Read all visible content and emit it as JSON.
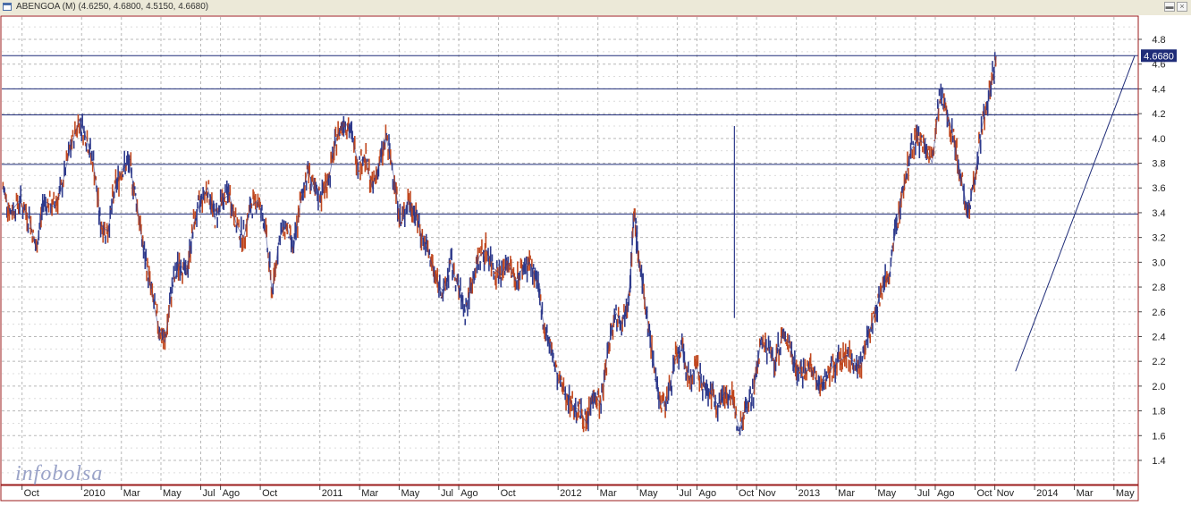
{
  "window": {
    "title": "ABENGOA (M) (4.6250, 4.6800, 4.5150, 4.6680)",
    "icon": "chart-window-icon",
    "buttons": [
      "minimize-icon",
      "close-icon"
    ]
  },
  "watermark": {
    "left": "info",
    "right": "bolsa"
  },
  "colors": {
    "up": "#2e3a8c",
    "down": "#c0471e",
    "grid": "#b8b8b8",
    "hline": "#1f2c78",
    "frame": "#9b1b1b",
    "price_tag_bg": "#1f2c78"
  },
  "last_price_label": "4.6680",
  "chart_data": {
    "type": "line",
    "title": "ABENGOA (M)",
    "subtitle": "(4.6250, 4.6800, 4.5150, 4.6680)",
    "xlabel": "",
    "ylabel": "",
    "ylim": [
      1.2,
      5.0
    ],
    "y_ticks": [
      1.4,
      1.6,
      1.8,
      2.0,
      2.2,
      2.4,
      2.6,
      2.8,
      3.0,
      3.2,
      3.4,
      3.6,
      3.8,
      4.0,
      4.2,
      4.4,
      4.6,
      4.8
    ],
    "y_tick_labels": [
      "1.4",
      "1.6",
      "1.8",
      "2.0",
      "2.2",
      "2.4",
      "2.6",
      "2.8",
      "3.0",
      "3.2",
      "3.4",
      "3.6",
      "3.8",
      "4.0",
      "4.2",
      "4.4",
      "4.6",
      "4.8"
    ],
    "x_ticks": [
      {
        "label": "Oct",
        "t": 2009.75
      },
      {
        "label": "2010",
        "t": 2010.0
      },
      {
        "label": "Mar",
        "t": 2010.167
      },
      {
        "label": "May",
        "t": 2010.333
      },
      {
        "label": "Jul",
        "t": 2010.5
      },
      {
        "label": "Ago",
        "t": 2010.583
      },
      {
        "label": "Oct",
        "t": 2010.75
      },
      {
        "label": "2011",
        "t": 2011.0
      },
      {
        "label": "Mar",
        "t": 2011.167
      },
      {
        "label": "May",
        "t": 2011.333
      },
      {
        "label": "Jul",
        "t": 2011.5
      },
      {
        "label": "Ago",
        "t": 2011.583
      },
      {
        "label": "Oct",
        "t": 2011.75
      },
      {
        "label": "2012",
        "t": 2012.0
      },
      {
        "label": "Mar",
        "t": 2012.167
      },
      {
        "label": "May",
        "t": 2012.333
      },
      {
        "label": "Jul",
        "t": 2012.5
      },
      {
        "label": "Ago",
        "t": 2012.583
      },
      {
        "label": "Oct",
        "t": 2012.75
      },
      {
        "label": "Nov",
        "t": 2012.833
      },
      {
        "label": "2013",
        "t": 2013.0
      },
      {
        "label": "Mar",
        "t": 2013.167
      },
      {
        "label": "May",
        "t": 2013.333
      },
      {
        "label": "Jul",
        "t": 2013.5
      },
      {
        "label": "Ago",
        "t": 2013.583
      },
      {
        "label": "Oct",
        "t": 2013.75
      },
      {
        "label": "Nov",
        "t": 2013.833
      },
      {
        "label": "2014",
        "t": 2014.0
      },
      {
        "label": "Mar",
        "t": 2014.167
      },
      {
        "label": "May",
        "t": 2014.333
      }
    ],
    "horizontal_lines": [
      3.39,
      3.79,
      4.19,
      4.4,
      4.668
    ],
    "trendline": {
      "start": {
        "t": 2013.92,
        "y": 2.12
      },
      "end": {
        "t": 2014.42,
        "y": 4.668
      }
    },
    "series": [
      {
        "values": [
          [
            2009.67,
            3.6
          ],
          [
            2009.7,
            3.4
          ],
          [
            2009.74,
            3.5
          ],
          [
            2009.78,
            3.35
          ],
          [
            2009.81,
            3.1
          ],
          [
            2009.84,
            3.5
          ],
          [
            2009.88,
            3.45
          ],
          [
            2009.91,
            3.55
          ],
          [
            2009.95,
            3.9
          ],
          [
            2009.99,
            4.15
          ],
          [
            2010.02,
            4.0
          ],
          [
            2010.05,
            3.8
          ],
          [
            2010.08,
            3.3
          ],
          [
            2010.11,
            3.25
          ],
          [
            2010.14,
            3.6
          ],
          [
            2010.17,
            3.75
          ],
          [
            2010.2,
            3.8
          ],
          [
            2010.23,
            3.5
          ],
          [
            2010.26,
            3.1
          ],
          [
            2010.29,
            2.8
          ],
          [
            2010.32,
            2.5
          ],
          [
            2010.35,
            2.35
          ],
          [
            2010.38,
            2.8
          ],
          [
            2010.41,
            3.0
          ],
          [
            2010.44,
            2.9
          ],
          [
            2010.47,
            3.3
          ],
          [
            2010.5,
            3.5
          ],
          [
            2010.53,
            3.6
          ],
          [
            2010.56,
            3.35
          ],
          [
            2010.59,
            3.5
          ],
          [
            2010.62,
            3.55
          ],
          [
            2010.65,
            3.3
          ],
          [
            2010.68,
            3.2
          ],
          [
            2010.71,
            3.45
          ],
          [
            2010.74,
            3.5
          ],
          [
            2010.77,
            3.3
          ],
          [
            2010.8,
            2.75
          ],
          [
            2010.83,
            3.2
          ],
          [
            2010.86,
            3.3
          ],
          [
            2010.89,
            3.1
          ],
          [
            2010.92,
            3.5
          ],
          [
            2010.95,
            3.75
          ],
          [
            2010.98,
            3.55
          ],
          [
            2011.01,
            3.55
          ],
          [
            2011.04,
            3.7
          ],
          [
            2011.07,
            4.0
          ],
          [
            2011.1,
            4.15
          ],
          [
            2011.13,
            4.05
          ],
          [
            2011.16,
            3.8
          ],
          [
            2011.19,
            3.85
          ],
          [
            2011.22,
            3.6
          ],
          [
            2011.25,
            3.8
          ],
          [
            2011.28,
            4.0
          ],
          [
            2011.31,
            3.7
          ],
          [
            2011.34,
            3.3
          ],
          [
            2011.37,
            3.5
          ],
          [
            2011.4,
            3.4
          ],
          [
            2011.43,
            3.2
          ],
          [
            2011.46,
            3.05
          ],
          [
            2011.49,
            2.85
          ],
          [
            2011.52,
            2.75
          ],
          [
            2011.55,
            3.0
          ],
          [
            2011.58,
            2.8
          ],
          [
            2011.61,
            2.6
          ],
          [
            2011.64,
            2.85
          ],
          [
            2011.67,
            3.05
          ],
          [
            2011.7,
            3.1
          ],
          [
            2011.73,
            2.95
          ],
          [
            2011.76,
            2.9
          ],
          [
            2011.79,
            3.0
          ],
          [
            2011.82,
            2.85
          ],
          [
            2011.85,
            2.95
          ],
          [
            2011.88,
            3.0
          ],
          [
            2011.91,
            2.85
          ],
          [
            2011.94,
            2.5
          ],
          [
            2011.97,
            2.3
          ],
          [
            2012.0,
            2.05
          ],
          [
            2012.03,
            1.95
          ],
          [
            2012.06,
            1.85
          ],
          [
            2012.09,
            1.8
          ],
          [
            2012.12,
            1.7
          ],
          [
            2012.15,
            1.95
          ],
          [
            2012.18,
            1.85
          ],
          [
            2012.21,
            2.3
          ],
          [
            2012.24,
            2.6
          ],
          [
            2012.27,
            2.5
          ],
          [
            2012.3,
            2.8
          ],
          [
            2012.32,
            3.4
          ],
          [
            2012.34,
            3.0
          ],
          [
            2012.37,
            2.6
          ],
          [
            2012.4,
            2.2
          ],
          [
            2012.43,
            1.85
          ],
          [
            2012.46,
            1.9
          ],
          [
            2012.49,
            2.2
          ],
          [
            2012.52,
            2.3
          ],
          [
            2012.55,
            2.05
          ],
          [
            2012.58,
            2.15
          ],
          [
            2012.61,
            2.0
          ],
          [
            2012.64,
            1.95
          ],
          [
            2012.67,
            1.85
          ],
          [
            2012.7,
            1.95
          ],
          [
            2012.73,
            1.9
          ],
          [
            2012.76,
            1.65
          ],
          [
            2012.79,
            1.85
          ],
          [
            2012.82,
            1.95
          ],
          [
            2012.85,
            2.35
          ],
          [
            2012.88,
            2.3
          ],
          [
            2012.91,
            2.2
          ],
          [
            2012.94,
            2.4
          ],
          [
            2012.97,
            2.35
          ],
          [
            2013.0,
            2.15
          ],
          [
            2013.03,
            2.1
          ],
          [
            2013.06,
            2.15
          ],
          [
            2013.09,
            2.0
          ],
          [
            2013.12,
            2.05
          ],
          [
            2013.15,
            2.15
          ],
          [
            2013.18,
            2.2
          ],
          [
            2013.21,
            2.25
          ],
          [
            2013.24,
            2.2
          ],
          [
            2013.27,
            2.15
          ],
          [
            2013.3,
            2.4
          ],
          [
            2013.33,
            2.6
          ],
          [
            2013.36,
            2.8
          ],
          [
            2013.39,
            2.9
          ],
          [
            2013.42,
            3.3
          ],
          [
            2013.45,
            3.6
          ],
          [
            2013.48,
            3.9
          ],
          [
            2013.51,
            4.0
          ],
          [
            2013.54,
            3.95
          ],
          [
            2013.57,
            3.8
          ],
          [
            2013.6,
            4.3
          ],
          [
            2013.63,
            4.25
          ],
          [
            2013.66,
            4.0
          ],
          [
            2013.69,
            3.7
          ],
          [
            2013.72,
            3.4
          ],
          [
            2013.75,
            3.7
          ],
          [
            2013.78,
            4.1
          ],
          [
            2013.81,
            4.35
          ],
          [
            2013.84,
            4.668
          ]
        ]
      }
    ]
  }
}
